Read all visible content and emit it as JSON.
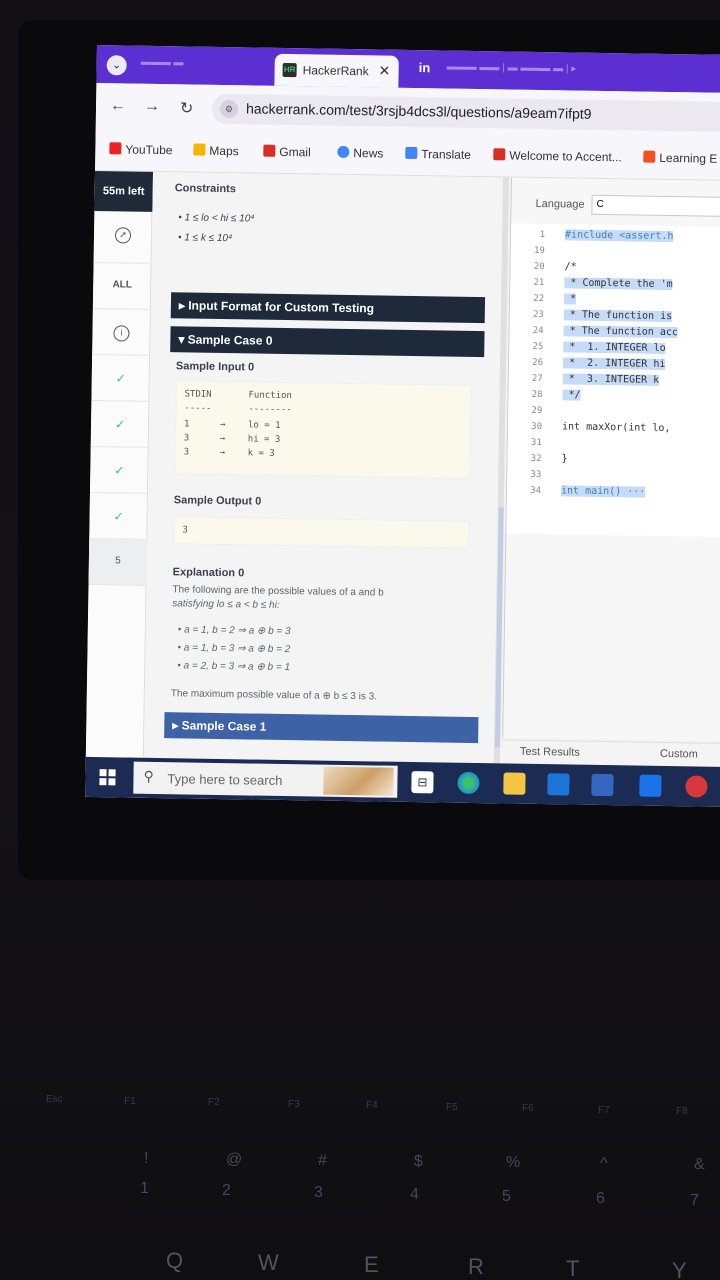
{
  "browser": {
    "active_tab_title": "HackerRank",
    "address": "hackerrank.com/test/3rsjb4dcs3l/questions/a9eam7ifpt9",
    "bookmarks": [
      "YouTube",
      "Maps",
      "Gmail",
      "News",
      "Translate",
      "Welcome to Accent...",
      "Learning E"
    ]
  },
  "rail": {
    "timer": "55m left",
    "all_label": "ALL",
    "current_number": "5"
  },
  "problem": {
    "constraints_heading": "Constraints",
    "constraints": [
      "1 ≤ lo < hi ≤ 10⁴",
      "1 ≤ k ≤ 10⁴"
    ],
    "input_format_bar": "Input Format for Custom Testing",
    "sample_case_0_bar": "Sample Case 0",
    "sample_input_heading": "Sample Input 0",
    "input_table": {
      "headers": [
        "STDIN",
        "Function"
      ],
      "dashes": [
        "-----",
        "--------"
      ],
      "rows": [
        [
          "1",
          "→",
          "lo = 1"
        ],
        [
          "3",
          "→",
          "hi = 3"
        ],
        [
          "3",
          "→",
          "k = 3"
        ]
      ]
    },
    "sample_output_heading": "Sample Output 0",
    "sample_output": "3",
    "explanation_heading": "Explanation 0",
    "explanation_line1": "The following are the possible values of a and b",
    "explanation_line2": "satisfying lo ≤ a < b ≤ hi:",
    "explanation_items": [
      "a = 1, b = 2 ⇒ a ⊕ b = 3",
      "a = 1, b = 3 ⇒ a ⊕ b = 2",
      "a = 2, b = 3 ⇒ a ⊕ b = 1"
    ],
    "explanation_conclusion": "The maximum possible value of a ⊕ b ≤ 3 is 3.",
    "sample_case_1_bar": "Sample Case 1"
  },
  "editor": {
    "language_label": "Language",
    "language_value": "C",
    "line_numbers": [
      "1",
      "19",
      "20",
      "21",
      "22",
      "23",
      "24",
      "25",
      "26",
      "27",
      "28",
      "29",
      "30",
      "31",
      "32",
      "33",
      "34"
    ],
    "lines": [
      "#include <assert.h",
      "",
      "/*",
      " * Complete the 'm",
      " *",
      " * The function is",
      " * The function acc",
      " *  1. INTEGER lo",
      " *  2. INTEGER hi",
      " *  3. INTEGER k",
      " */",
      "",
      "int maxXor(int lo,",
      "",
      "}",
      "",
      "int main() ···"
    ],
    "test_results_label": "Test Results",
    "custom_label": "Custom"
  },
  "taskbar": {
    "search_placeholder": "Type here to search"
  },
  "keyboard": {
    "fn_row": [
      "Esc",
      "F1",
      "F2",
      "F3",
      "F4",
      "F5",
      "F6",
      "F7",
      "F8"
    ],
    "num_row_top": [
      "!",
      "@",
      "#",
      "$",
      "%",
      "^",
      "&"
    ],
    "num_row": [
      "1",
      "2",
      "3",
      "4",
      "5",
      "6",
      "7"
    ],
    "letter_row": [
      "Q",
      "W",
      "E",
      "R",
      "T",
      "Y"
    ]
  },
  "colors": {
    "tab_strip": "#5b2fd1",
    "dark_bar": "#1e2a3a",
    "sample_case_1_bar": "#3e62a6",
    "check": "#2ec866",
    "taskbar": "#1b2b53"
  }
}
